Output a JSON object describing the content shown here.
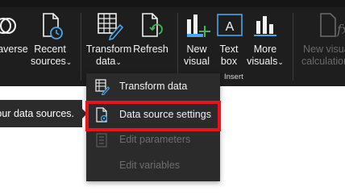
{
  "ribbon": {
    "buttons": [
      {
        "label1": "averse",
        "label2": "",
        "icon": "connector-icon",
        "disabled": false
      },
      {
        "label1": "Recent",
        "label2": "sources",
        "chevron": "⌄",
        "icon": "recent-sources-icon",
        "disabled": false
      },
      {
        "label1": "Transform",
        "label2": "data",
        "chevron": "⌄",
        "icon": "transform-data-icon",
        "disabled": false
      },
      {
        "label1": "Refresh",
        "label2": "",
        "icon": "refresh-icon",
        "disabled": false
      },
      {
        "label1": "New",
        "label2": "visual",
        "icon": "new-visual-icon",
        "disabled": false
      },
      {
        "label1": "Text",
        "label2": "box",
        "icon": "text-box-icon",
        "disabled": false
      },
      {
        "label1": "More",
        "label2": "visuals",
        "chevron": "⌄",
        "icon": "more-visuals-icon",
        "disabled": false
      },
      {
        "label1": "New visual",
        "label2": "calculation",
        "icon": "visual-calculation-icon",
        "disabled": true
      }
    ],
    "groups": {
      "insert": "Insert"
    }
  },
  "tooltip": {
    "text": "our data sources."
  },
  "menu": {
    "items": [
      {
        "label": "Transform data",
        "icon": "transform-data-icon",
        "disabled": false,
        "highlighted": false
      },
      {
        "label": "Data source settings",
        "icon": "data-source-settings-icon",
        "disabled": false,
        "highlighted": true
      },
      {
        "label": "Edit parameters",
        "icon": "edit-parameters-icon",
        "disabled": true,
        "highlighted": false
      },
      {
        "label": "Edit variables",
        "icon": "edit-variables-icon",
        "disabled": true,
        "highlighted": false
      }
    ]
  },
  "colors": {
    "ribbon_bg": "#1e1e1e",
    "menu_bg": "#2b2b2b",
    "highlight_border": "#e8141b",
    "accent_blue": "#4aa6e8",
    "accent_green": "#3fb950"
  }
}
